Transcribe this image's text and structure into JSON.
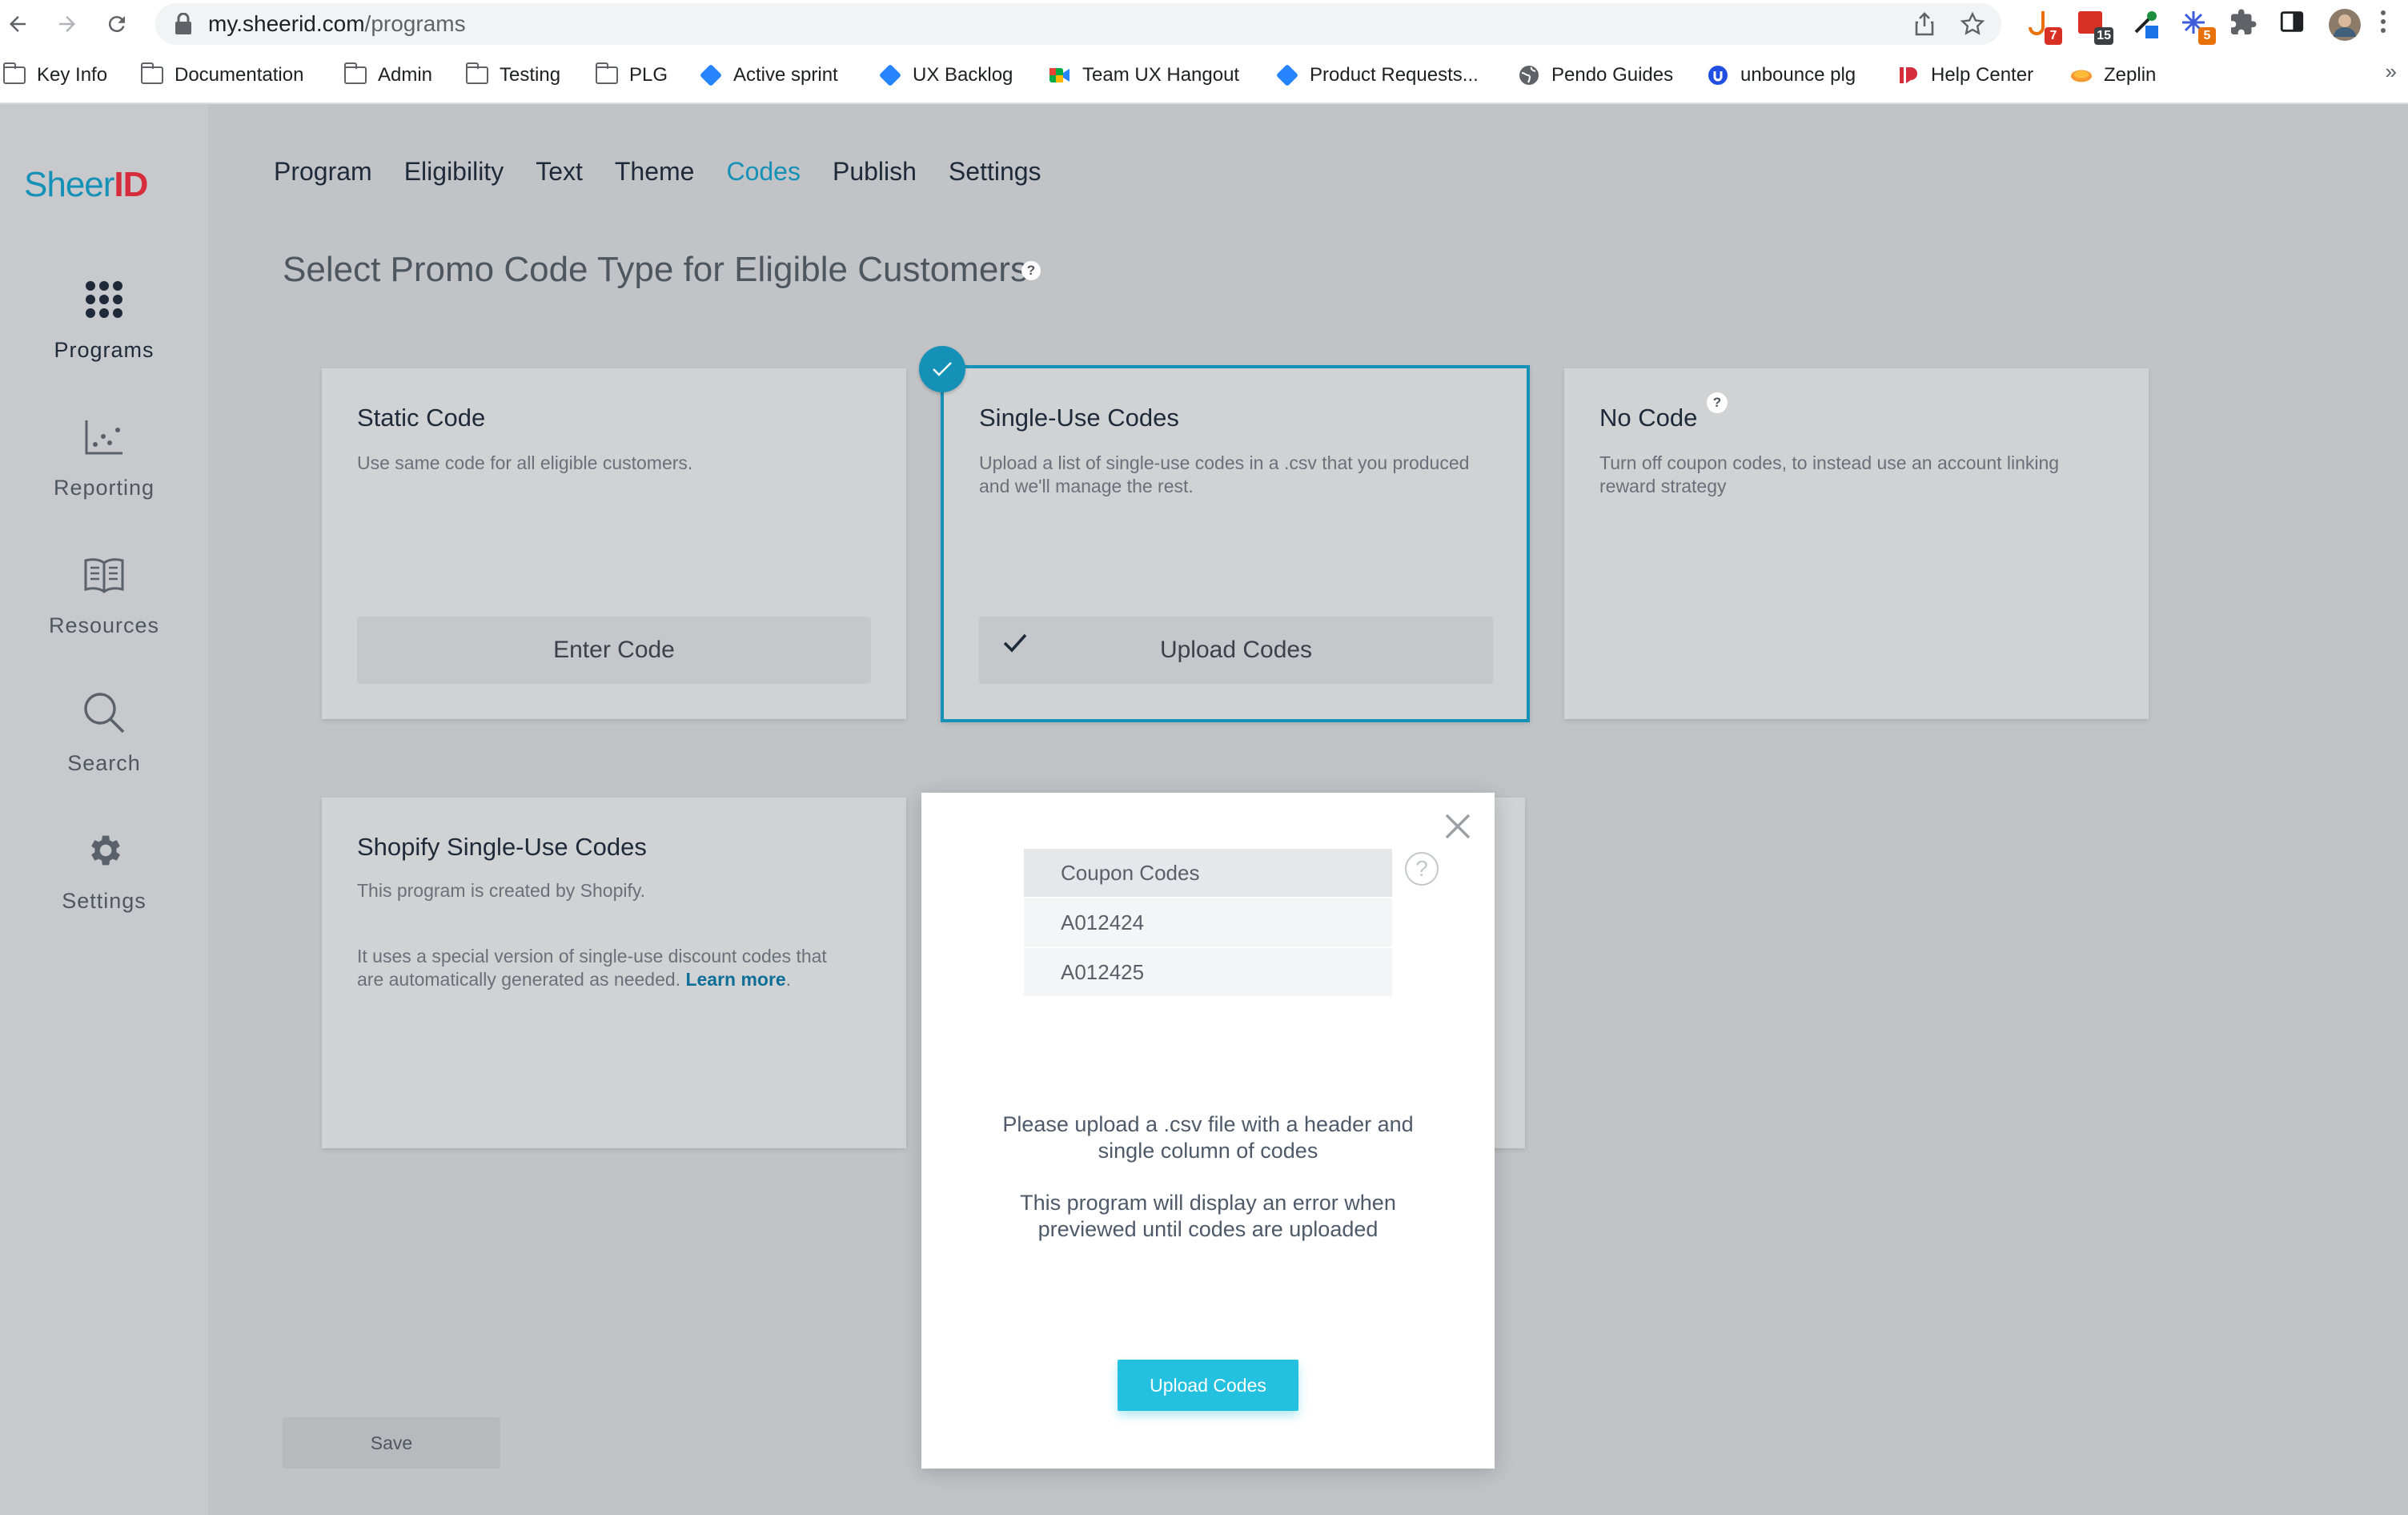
{
  "browser": {
    "url_host": "my.sheerid.com",
    "url_path": "/programs",
    "extension_badges": [
      "7",
      "15",
      "5"
    ],
    "bookmarks": [
      {
        "label": "Key Info",
        "icon": "folder-icon"
      },
      {
        "label": "Documentation",
        "icon": "folder-icon"
      },
      {
        "label": "Admin",
        "icon": "folder-icon"
      },
      {
        "label": "Testing",
        "icon": "folder-icon"
      },
      {
        "label": "PLG",
        "icon": "folder-icon"
      },
      {
        "label": "Active sprint",
        "icon": "jira-icon"
      },
      {
        "label": "UX Backlog",
        "icon": "jira-icon"
      },
      {
        "label": "Team UX Hangout",
        "icon": "meet-icon"
      },
      {
        "label": "Product Requests...",
        "icon": "jira-icon"
      },
      {
        "label": "Pendo Guides",
        "icon": "globe-icon"
      },
      {
        "label": "unbounce plg",
        "icon": "unbounce-icon"
      },
      {
        "label": "Help Center",
        "icon": "sheerid-icon"
      },
      {
        "label": "Zeplin",
        "icon": "zeplin-icon"
      }
    ],
    "more_label": "»"
  },
  "app": {
    "logo_text": "Sheer",
    "logo_mark": "ID",
    "sidebar": [
      {
        "label": "Programs",
        "icon": "grid-icon",
        "active": true
      },
      {
        "label": "Reporting",
        "icon": "chart-icon",
        "active": false
      },
      {
        "label": "Resources",
        "icon": "book-icon",
        "active": false
      },
      {
        "label": "Search",
        "icon": "search-icon",
        "active": false
      },
      {
        "label": "Settings",
        "icon": "gear-icon",
        "active": false
      }
    ],
    "tabs": [
      "Program",
      "Eligibility",
      "Text",
      "Theme",
      "Codes",
      "Publish",
      "Settings"
    ],
    "active_tab": "Codes",
    "heading": "Select Promo Code Type for Eligible Customers",
    "help_glyph": "?",
    "cards": {
      "static": {
        "title": "Static Code",
        "desc": "Use same code for all eligible customers.",
        "button": "Enter Code"
      },
      "single": {
        "title": "Single-Use Codes",
        "desc_1": "Upload a list of single-use codes in a .csv that you produced",
        "desc_2": "and we'll manage the rest.",
        "button": "Upload Codes",
        "check_glyph": "✓"
      },
      "none": {
        "title": "No Code",
        "desc_1": "Turn off coupon codes, to instead use an account linking",
        "desc_2": "reward strategy"
      },
      "shopify": {
        "title": "Shopify Single-Use Codes",
        "desc_1": "This program is created by Shopify.",
        "desc_2": "It uses a special version of single-use discount codes that",
        "desc_3": "are automatically generated as needed.",
        "link": "Learn more",
        "period": "."
      }
    },
    "save_label": "Save",
    "colors": {
      "accent": "#1591b7",
      "cta": "#24c0e0",
      "brand_red": "#d62d3d"
    }
  },
  "modal": {
    "table_header": "Coupon Codes",
    "codes": [
      "A012424",
      "A012425"
    ],
    "help_glyph": "?",
    "message_1a": "Please upload a .csv file with a header and",
    "message_1b": "single column of codes",
    "message_2a": "This program will display an error when",
    "message_2b": "previewed until codes are uploaded",
    "button": "Upload Codes"
  }
}
